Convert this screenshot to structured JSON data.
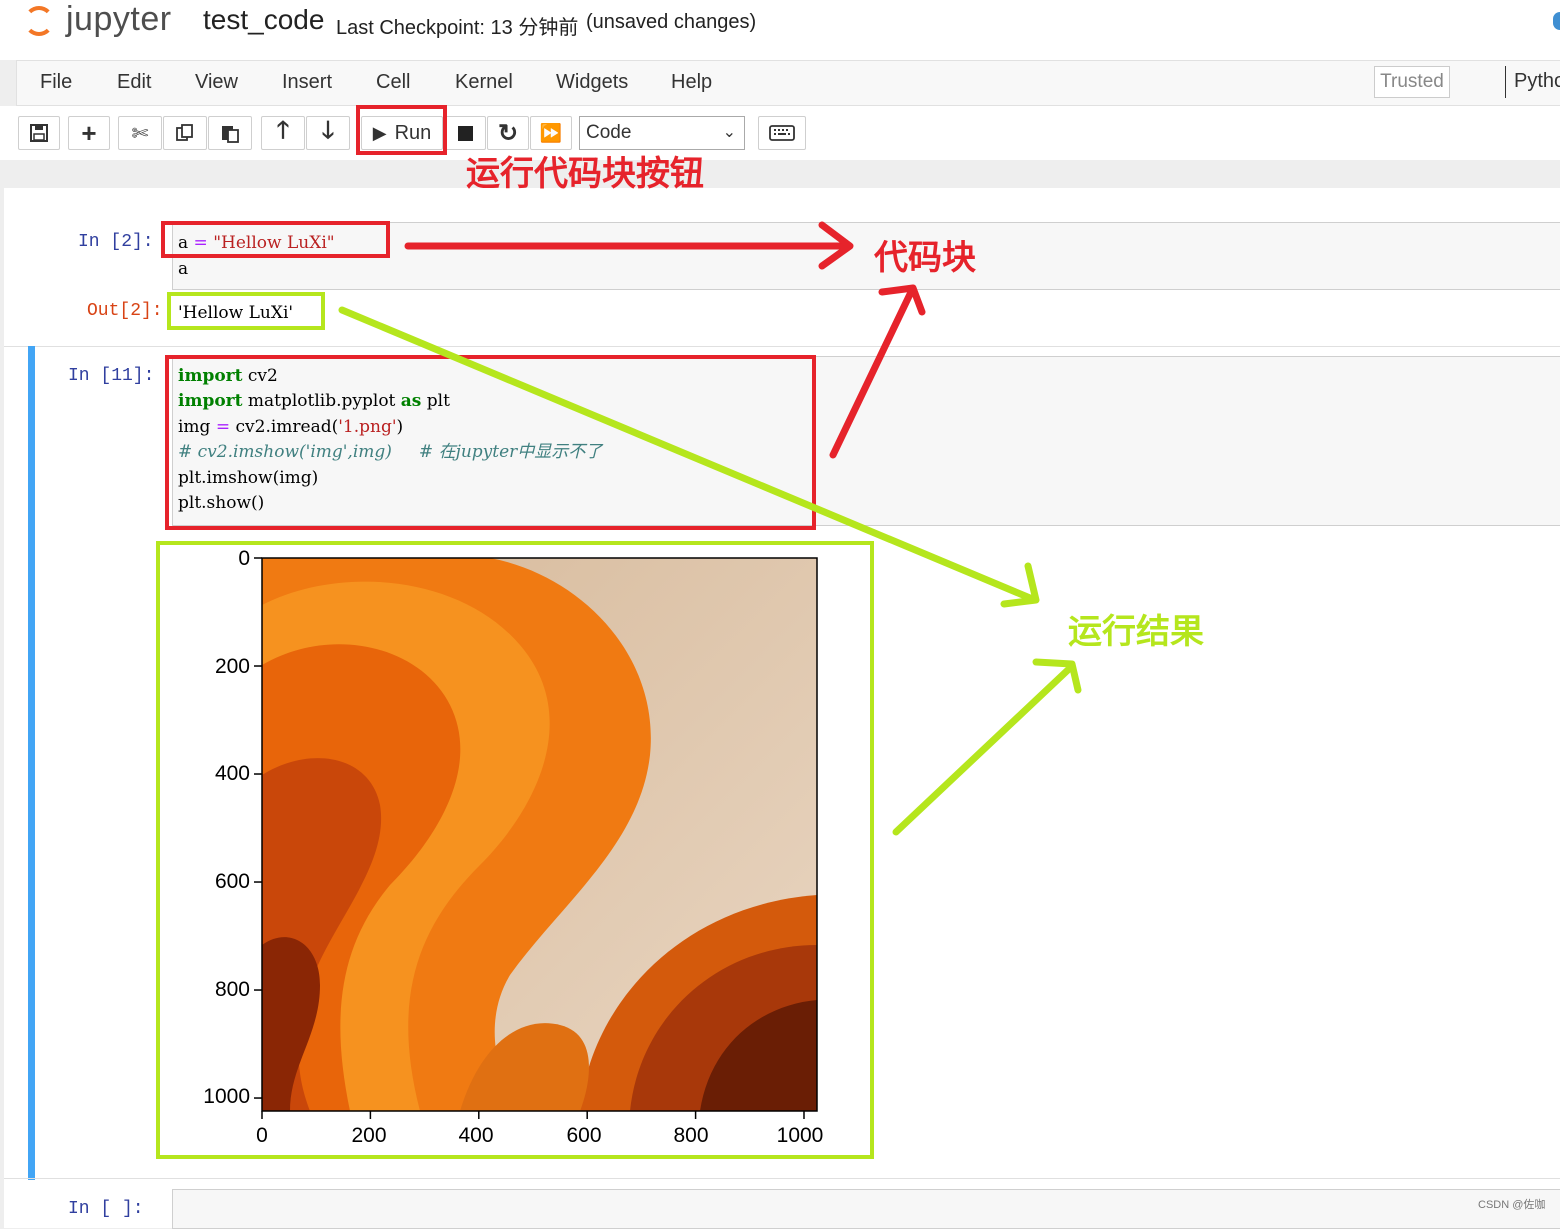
{
  "header": {
    "logo_text": "jupyter",
    "notebook_name": "test_code",
    "checkpoint": "Last Checkpoint: 13 分钟前",
    "unsaved": "(unsaved changes)"
  },
  "menubar": {
    "items": [
      "File",
      "Edit",
      "View",
      "Insert",
      "Cell",
      "Kernel",
      "Widgets",
      "Help"
    ],
    "trusted": "Trusted",
    "kernel_name": "Pytho"
  },
  "toolbar": {
    "run_label": "Run",
    "cell_type": "Code"
  },
  "cells": [
    {
      "prompt_in": "In  [2]:",
      "lines": [
        "a = \"Hellow LuXi\"",
        "a"
      ],
      "prompt_out": "Out[2]:",
      "output": "'Hellow LuXi'"
    },
    {
      "prompt_in": "In  [11]:",
      "lines": [
        "import cv2",
        "import matplotlib.pyplot as plt",
        "img = cv2.imread('1.png')",
        "# cv2.imshow('img',img)     # 在jupyter中显示不了",
        "plt.imshow(img)",
        "plt.show()"
      ]
    },
    {
      "prompt_in": "In  [ ]:"
    }
  ],
  "annotations": {
    "run_button": "运行代码块按钮",
    "code_block": "代码块",
    "run_result": "运行结果"
  },
  "chart_data": {
    "type": "image",
    "x_ticks": [
      "0",
      "200",
      "400",
      "600",
      "800",
      "1000"
    ],
    "y_ticks": [
      "0",
      "200",
      "400",
      "600",
      "800",
      "1000"
    ],
    "xlim": [
      0,
      1024
    ],
    "ylim": [
      1024,
      0
    ]
  },
  "watermark": "CSDN @佐咖",
  "colors": {
    "annotation_red": "#e6232b",
    "annotation_green": "#b5e61d",
    "selected_bar": "#42a5f5"
  }
}
